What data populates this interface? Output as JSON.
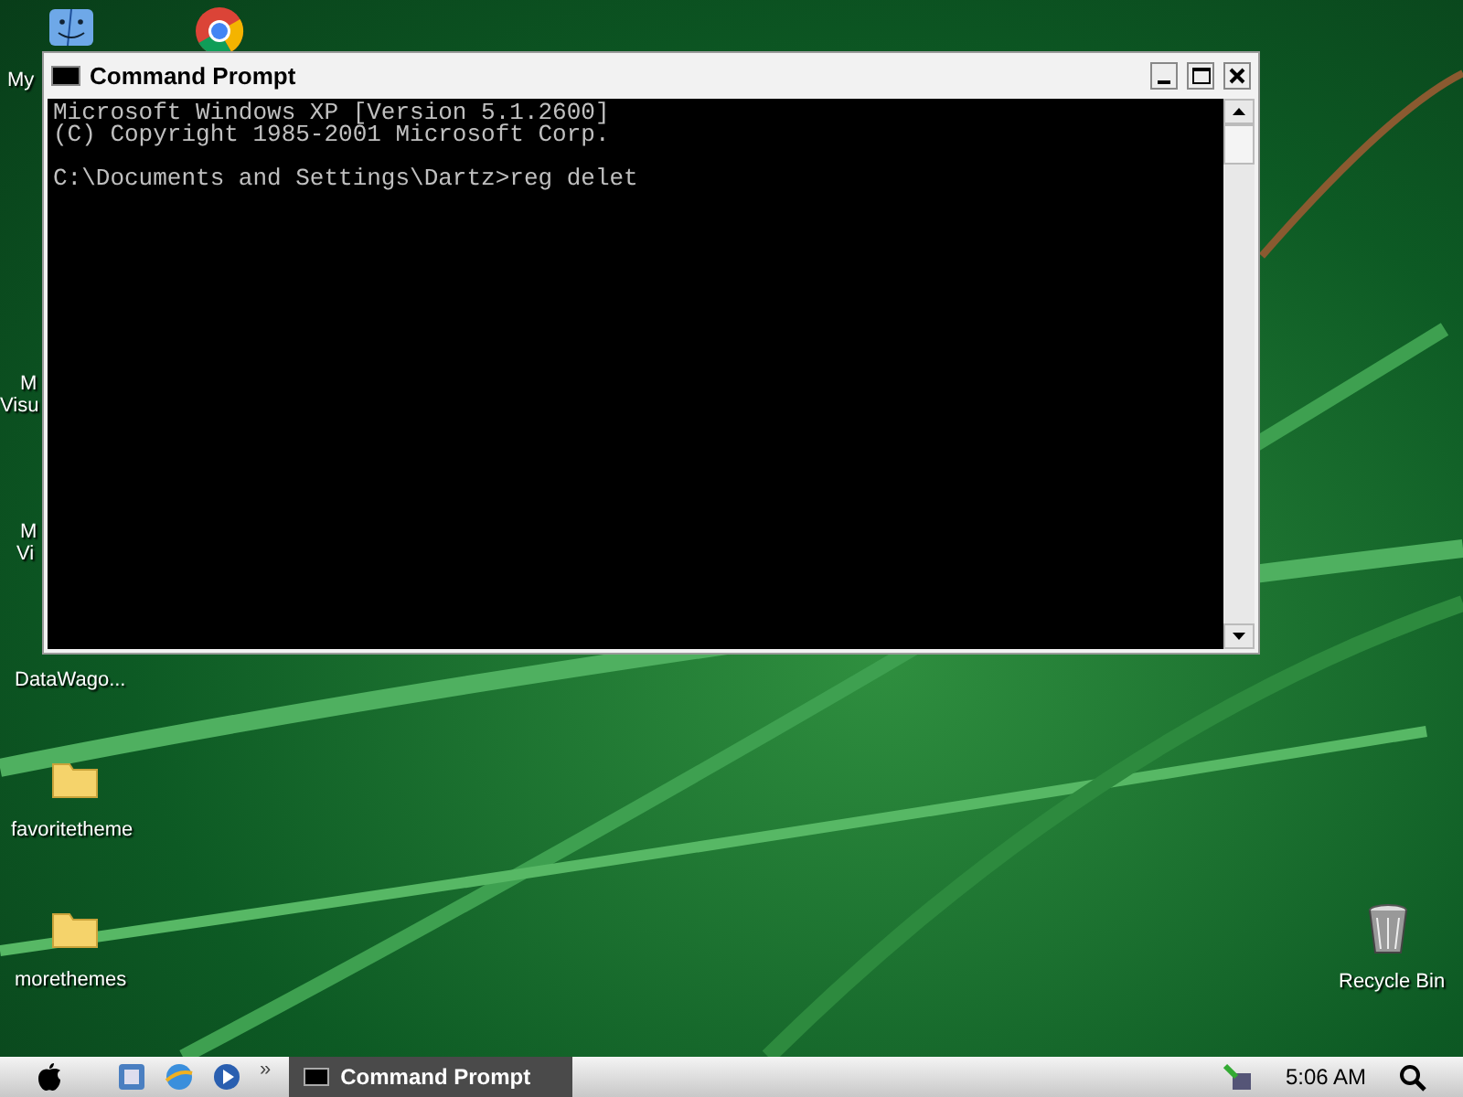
{
  "desktop_icons": [
    {
      "kind": "finder",
      "label": "My"
    },
    {
      "kind": "chrome"
    },
    {
      "kind": "none",
      "label": "M"
    },
    {
      "kind": "none",
      "label": "Visu"
    },
    {
      "kind": "none",
      "label": "M"
    },
    {
      "kind": "none",
      "label": "Vi"
    },
    {
      "kind": "none",
      "label": "DataWago..."
    },
    {
      "kind": "folder",
      "label": "favoritetheme"
    },
    {
      "kind": "folder",
      "label": "morethemes"
    },
    {
      "kind": "recycle",
      "label": "Recycle Bin"
    }
  ],
  "window": {
    "title": "Command Prompt",
    "console_blocks": [
      [
        "Microsoft Windows XP [Version 5.1.2600]",
        "(C) Copyright 1985-2001 Microsoft Corp."
      ],
      [
        "C:\\Documents and Settings\\Dartz>reg delet"
      ]
    ]
  },
  "taskbar": {
    "chevron": "»",
    "tasks": [
      {
        "label": "Command Prompt",
        "selected": true
      }
    ],
    "clock": "5:06 AM"
  }
}
